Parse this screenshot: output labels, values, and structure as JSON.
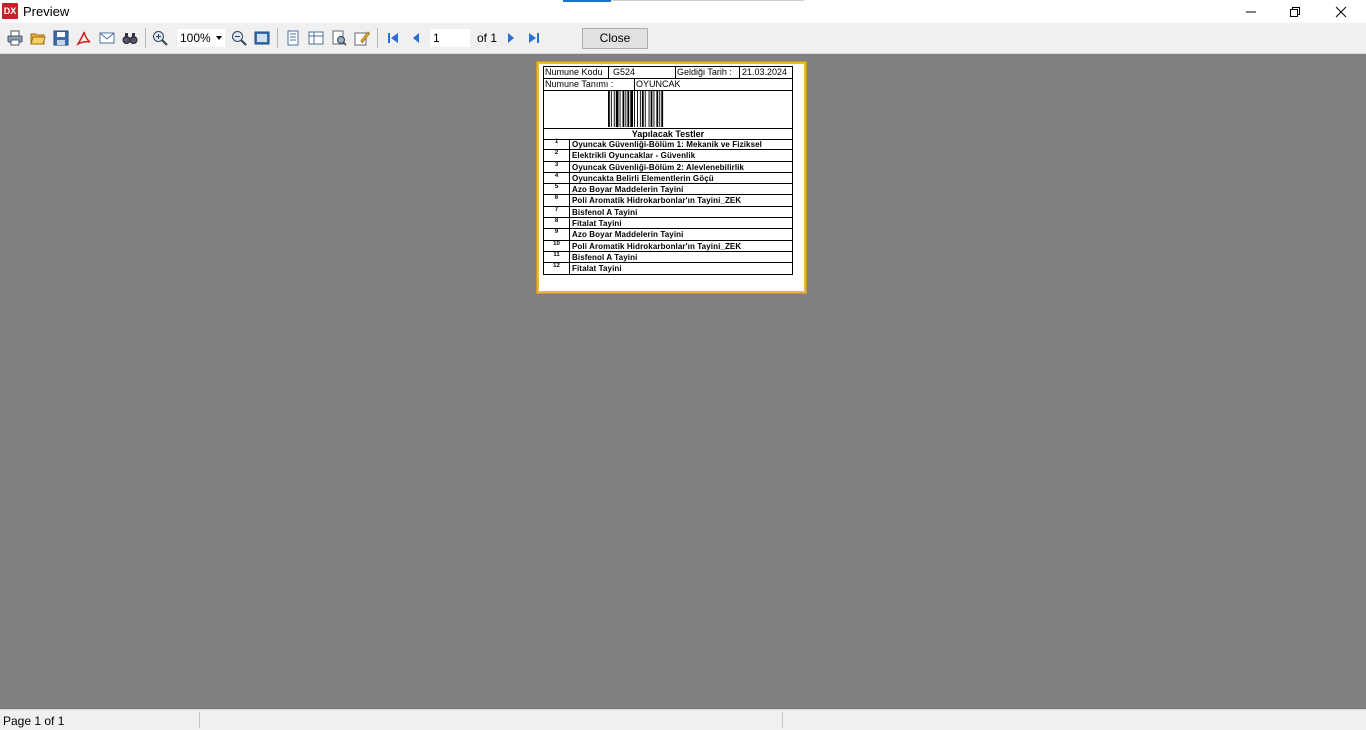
{
  "window": {
    "title": "Preview",
    "app_icon_text": "DX"
  },
  "toolbar": {
    "zoom_value": "100%",
    "page_value": "1",
    "page_of": "of 1",
    "close_label": "Close"
  },
  "report": {
    "sample_code_label": "Numune Kodu",
    "sample_code_value": "G524",
    "arrival_date_label": "Geldiği Tarih :",
    "arrival_date_value": "21.03.2024",
    "sample_desc_label": "Numune Tanımı :",
    "sample_desc_value": "OYUNCAK",
    "tests_title": "Yapılacak Testler",
    "tests": [
      {
        "no": "1",
        "name": "Oyuncak Güvenliği-Bölüm 1: Mekanik ve Fiziksel"
      },
      {
        "no": "2",
        "name": "Elektrikli Oyuncaklar - Güvenlik"
      },
      {
        "no": "3",
        "name": "Oyuncak Güvenliği-Bölüm 2: Alevlenebilirlik"
      },
      {
        "no": "4",
        "name": "Oyuncakta Belirli Elementlerin Göçü"
      },
      {
        "no": "5",
        "name": "Azo Boyar Maddelerin Tayini"
      },
      {
        "no": "6",
        "name": "Poli Aromatik Hidrokarbonlar'ın Tayini_ZEK"
      },
      {
        "no": "7",
        "name": "Bisfenol A Tayini"
      },
      {
        "no": "8",
        "name": "Fitalat Tayini"
      },
      {
        "no": "9",
        "name": "Azo Boyar Maddelerin Tayini"
      },
      {
        "no": "10",
        "name": "Poli Aromatik Hidrokarbonlar'ın Tayini_ZEK"
      },
      {
        "no": "11",
        "name": "Bisfenol A Tayini"
      },
      {
        "no": "12",
        "name": "Fitalat Tayini"
      }
    ]
  },
  "status": {
    "page_text": "Page 1 of 1"
  },
  "icons": [
    "print-icon",
    "open-icon",
    "save-icon",
    "pdf-icon",
    "email-icon",
    "find-icon",
    "zoom-in-icon",
    "zoom-out-icon",
    "fit-page-icon",
    "single-page-icon",
    "multi-page-icon",
    "page-setup-icon",
    "edit-icon",
    "first-page-icon",
    "prev-page-icon",
    "next-page-icon",
    "last-page-icon"
  ],
  "colors": {
    "page_border": "#e8b838",
    "app_icon": "#c8202a",
    "nav_arrow": "#2a6fd6"
  }
}
